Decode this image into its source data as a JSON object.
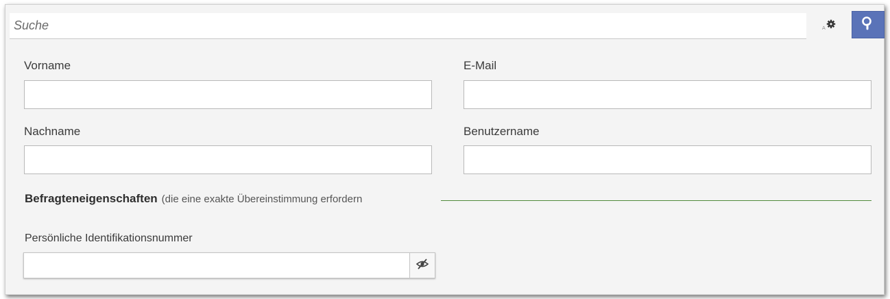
{
  "search": {
    "placeholder": "Suche",
    "options_icon": "gear-options-icon",
    "submit_icon": "search-icon",
    "submit_color": "#5a73b8"
  },
  "fields": {
    "vorname": {
      "label": "Vorname",
      "value": ""
    },
    "email": {
      "label": "E-Mail",
      "value": ""
    },
    "nachname": {
      "label": "Nachname",
      "value": ""
    },
    "benutzername": {
      "label": "Benutzername",
      "value": ""
    }
  },
  "section": {
    "title": "Befragteneigenschaften",
    "subtitle": "(die eine exakte Übereinstimmung erfordern",
    "line_color": "#4f8a3a"
  },
  "pin": {
    "label": "Persönliche Identifikationsnummer",
    "value": "",
    "toggle_icon": "eye-slash-icon"
  }
}
